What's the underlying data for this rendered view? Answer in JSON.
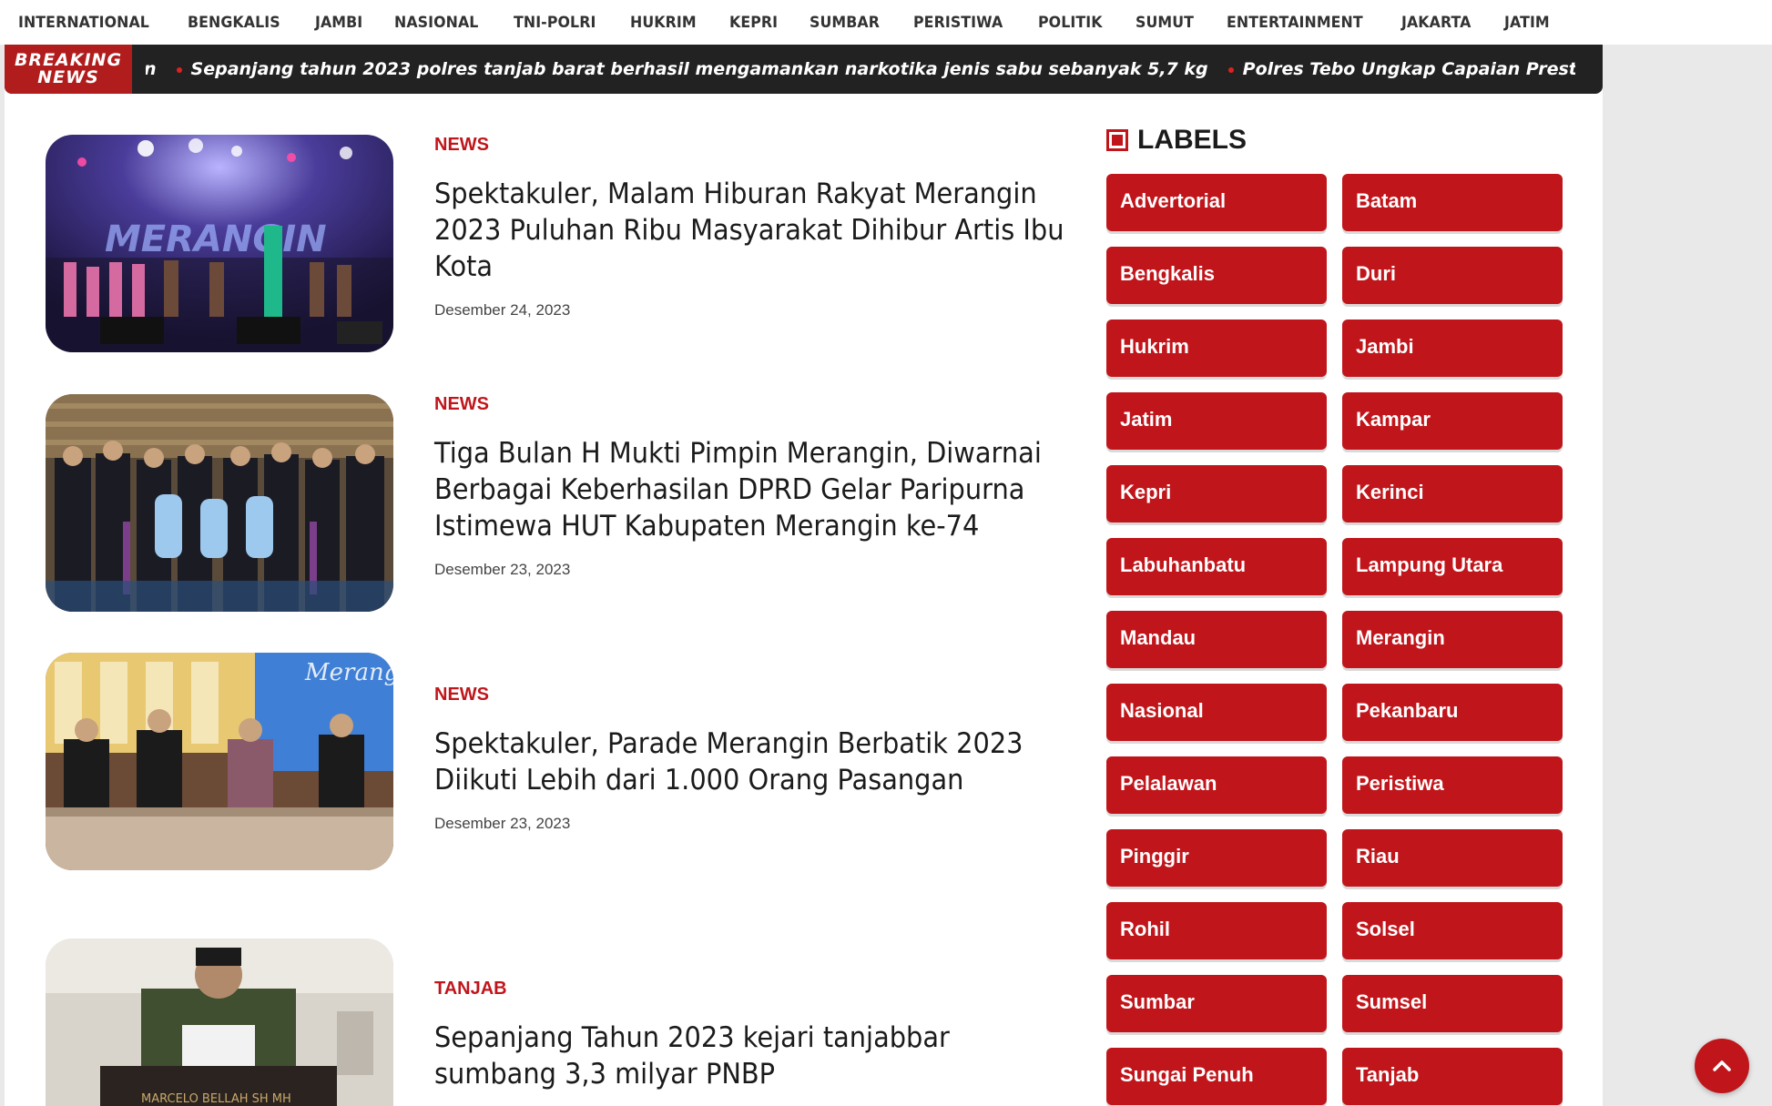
{
  "nav": {
    "items": [
      "INTERNATIONAL",
      "BENGKALIS",
      "JAMBI",
      "NASIONAL",
      "TNI-POLRI",
      "HUKRIM",
      "KEPRI",
      "SUMBAR",
      "PERISTIWA",
      "POLITIK",
      "SUMUT",
      "ENTERTAINMENT",
      "JAKARTA",
      "JATIM"
    ]
  },
  "ticker": {
    "label_line1": "BREAKING",
    "label_line2": "NEWS",
    "items": [
      "n",
      "Sepanjang tahun 2023 polres tanjab barat berhasil mengamankan narkotika jenis sabu sebanyak 5,7 kg",
      "Polres Tebo Ungkap Capaian Prestasi, mus"
    ]
  },
  "posts": [
    {
      "category": "NEWS",
      "title": "Spektakuler, Malam Hiburan Rakyat Merangin 2023 Puluhan Ribu Masyarakat Dihibur Artis Ibu Kota",
      "date": "Desember 24, 2023",
      "image_text": "MERANGIN"
    },
    {
      "category": "NEWS",
      "title": "Tiga Bulan H Mukti Pimpin Merangin, Diwarnai Berbagai Keberhasilan DPRD Gelar Paripurna Istimewa HUT Kabupaten Merangin ke-74",
      "date": "Desember 23, 2023"
    },
    {
      "category": "NEWS",
      "title": "Spektakuler, Parade Merangin Berbatik 2023 Diikuti Lebih dari 1.000 Orang Pasangan",
      "date": "Desember 23, 2023",
      "image_text": "Merang Berbat"
    },
    {
      "category": "TANJAB",
      "title": "Sepanjang Tahun 2023 kejari tanjabbar sumbang 3,3 milyar PNBP",
      "date": "",
      "image_text": "MARCELO BELLAH SH MH"
    }
  ],
  "sidebar": {
    "title": "LABELS",
    "labels": [
      "Advertorial",
      "Batam",
      "Bengkalis",
      "Duri",
      "Hukrim",
      "Jambi",
      "Jatim",
      "Kampar",
      "Kepri",
      "Kerinci",
      "Labuhanbatu",
      "Lampung Utara",
      "Mandau",
      "Merangin",
      "Nasional",
      "Pekanbaru",
      "Pelalawan",
      "Peristiwa",
      "Pinggir",
      "Riau",
      "Rohil",
      "Solsel",
      "Sumbar",
      "Sumsel",
      "Sungai Penuh",
      "Tanjab"
    ]
  },
  "colors": {
    "accent": "#c0161b",
    "ticker_bg": "#222222",
    "page_bg": "#ffffff",
    "outer_bg": "#e9e9ea"
  },
  "icons": {
    "labels_marker": "square-marker-icon",
    "back_to_top": "chevron-up-icon"
  }
}
